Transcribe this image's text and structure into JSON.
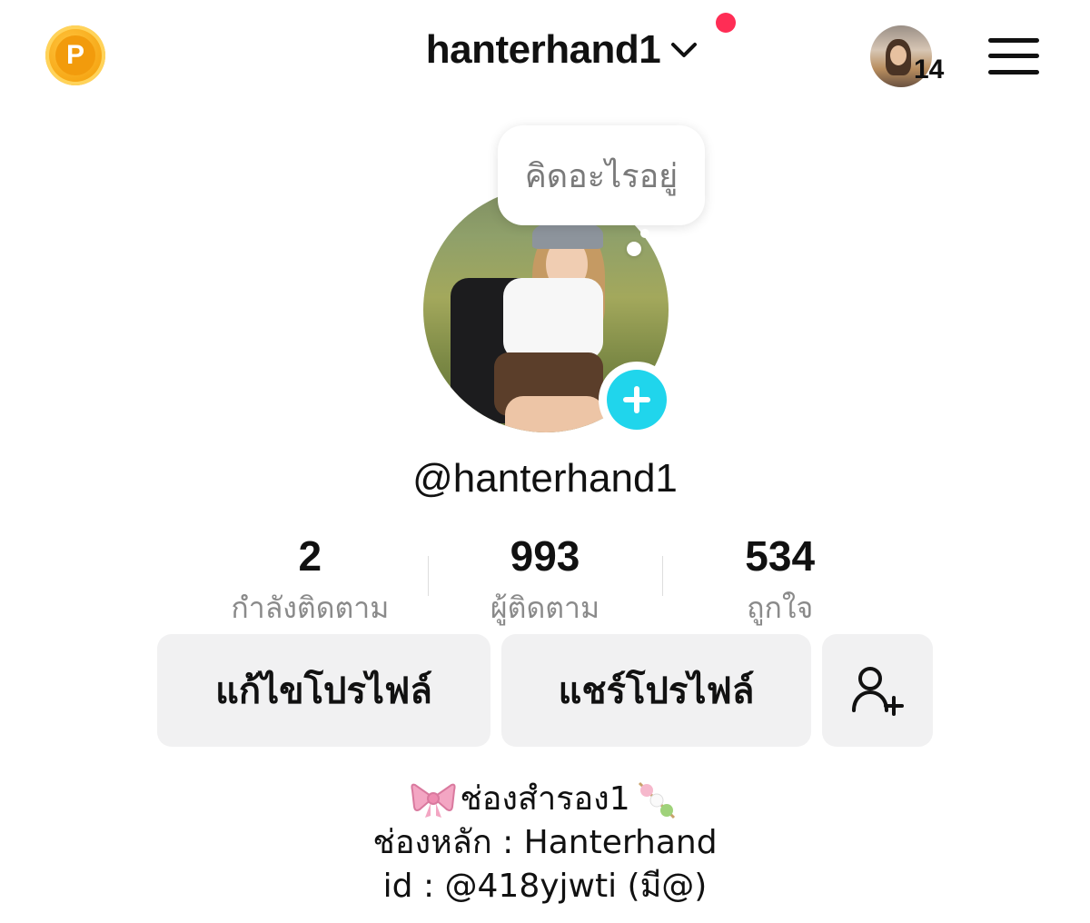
{
  "header": {
    "coin_icon_letter": "P",
    "username": "hanterhand1",
    "notification_count": "14"
  },
  "profile": {
    "thought_bubble": "คิดอะไรอยู่",
    "handle": "@hanterhand1"
  },
  "stats": [
    {
      "value": "2",
      "label": "กำลังติดตาม"
    },
    {
      "value": "993",
      "label": "ผู้ติดตาม"
    },
    {
      "value": "534",
      "label": "ถูกใจ"
    }
  ],
  "actions": {
    "edit_profile": "แก้ไขโปรไฟล์",
    "share_profile": "แชร์โปรไฟล์"
  },
  "bio": {
    "line1": "ช่องสำรอง1",
    "line2": "ช่องหลัก : Hanterhand",
    "line3": "id : @418yjwti (มี@)"
  },
  "colors": {
    "accent": "#20d5ec",
    "notification_dot": "#ff2d55",
    "coin": "#f6a614",
    "button_bg": "#f1f1f2"
  }
}
